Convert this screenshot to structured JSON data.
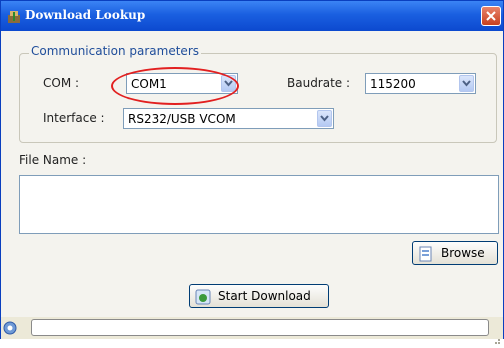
{
  "window": {
    "title": "Download Lookup"
  },
  "comm": {
    "legend": "Communication parameters",
    "com_label": "COM :",
    "com_value": "COM1",
    "baud_label": "Baudrate :",
    "baud_value": "115200",
    "interface_label": "Interface :",
    "interface_value": "RS232/USB VCOM"
  },
  "file": {
    "label": "File Name :",
    "value": ""
  },
  "buttons": {
    "browse": "Browse",
    "start_download": "Start Download"
  },
  "status": {
    "text": ""
  },
  "colors": {
    "highlight": "#e22020",
    "titlebar": "#1a5fe0",
    "legend_text": "#1f4d9a"
  },
  "icons": [
    "app-icon",
    "close-icon",
    "dropdown-arrow-icon",
    "browse-icon",
    "download-icon",
    "status-icon",
    "resize-grip-icon"
  ]
}
